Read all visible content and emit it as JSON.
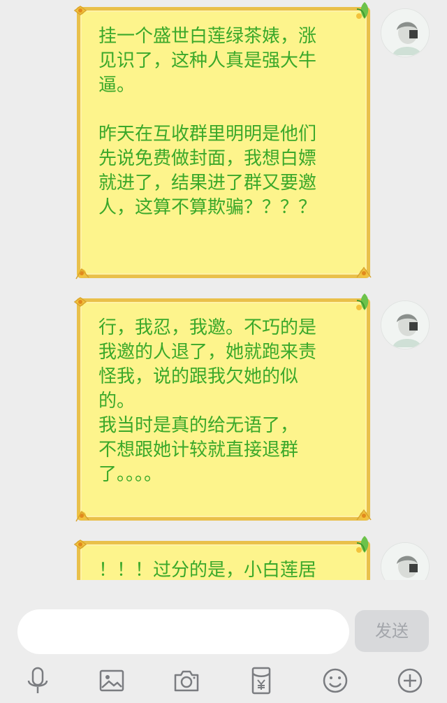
{
  "messages": [
    {
      "text": "挂一个盛世白莲绿茶婊，涨\n见识了，这种人真是强大牛\n逼。\n\n昨天在互收群里明明是他们\n先说免费做封面，我想白嫖\n就进了，结果进了群又要邀\n人，这算不算欺骗？？？？"
    },
    {
      "text": "行，我忍，我邀。不巧的是\n我邀的人退了，她就跑来责\n怪我，说的跟我欠她的似\n的。\n我当时是真的给无语了，\n不想跟她计较就直接退群\n了。。。。"
    },
    {
      "text": "！！！过分的是，小白莲居"
    }
  ],
  "composer": {
    "input_placeholder": "",
    "send_label": "发送"
  },
  "toolbar": {
    "icons": [
      "microphone-icon",
      "image-icon",
      "camera-icon",
      "red-packet-icon",
      "emoji-icon",
      "plus-icon"
    ]
  },
  "colors": {
    "bubble_fill": "#fdf48c",
    "bubble_border": "#e9c04a",
    "message_text": "#3aa82a",
    "background": "#ededed"
  }
}
